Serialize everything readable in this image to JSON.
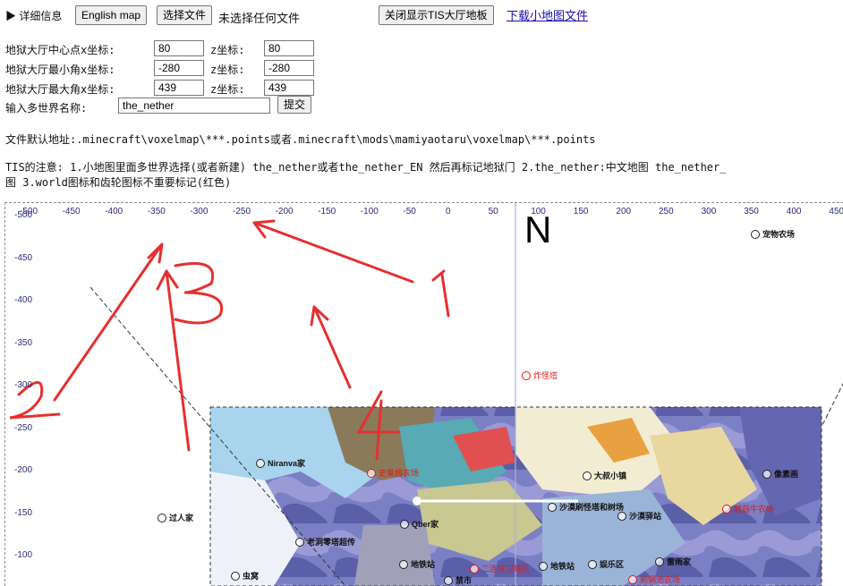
{
  "details_label": "▶ 详细信息",
  "buttons": {
    "english_map": "English map",
    "choose_file": "选择文件",
    "no_file": "未选择任何文件",
    "close_floor": "关闭显示TIS大厅地板",
    "download_link": "下载小地图文件",
    "submit": "提交"
  },
  "form": {
    "center_label": "地狱大厅中心点x坐标:",
    "center_x": "80",
    "center_z_label": "z坐标:",
    "center_z": "80",
    "min_label": "地狱大厅最小角x坐标:",
    "min_x": "-280",
    "min_z_label": "z坐标:",
    "min_z": "-280",
    "max_label": "地狱大厅最大角x坐标:",
    "max_x": "439",
    "max_z_label": "z坐标:",
    "max_z": "439",
    "world_label": "输入多世界名称:",
    "world_value": "the_nether"
  },
  "info": {
    "default_path": "文件默认地址:.minecraft\\voxelmap\\***.points或者.minecraft\\mods\\mamiyaotaru\\voxelmap\\***.points",
    "note_line1": "TIS的注意: 1.小地图里面多世界选择(或者新建) the_nether或者the_nether_EN 然后再标记地狱门 2.the_nether:中文地图 the_nether_",
    "note_line2": "图 3.world图标和齿轮图标不重要标记(红色)"
  },
  "annotations": [
    "1",
    "2",
    "3",
    "4"
  ],
  "map": {
    "north": "N",
    "x_ticks": [
      "-500",
      "-450",
      "-400",
      "-350",
      "-300",
      "-250",
      "-200",
      "-150",
      "-100",
      "-50",
      "0",
      "50",
      "100",
      "150",
      "200",
      "250",
      "300",
      "350",
      "400",
      "450"
    ],
    "y_ticks": [
      "-500",
      "-450",
      "-400",
      "-350",
      "-300",
      "-250",
      "-200",
      "-150",
      "-100"
    ],
    "markers": [
      {
        "name": "宠物农场",
        "color": "dark"
      },
      {
        "name": "炸怪塔",
        "color": "red"
      },
      {
        "name": "Niranva家",
        "color": "dark"
      },
      {
        "name": "史莱姆农场",
        "color": "red"
      },
      {
        "name": "大叔小镇",
        "color": "dark"
      },
      {
        "name": "像素画",
        "color": "dark"
      },
      {
        "name": "沙漠刷怪塔和树场",
        "color": "dark"
      },
      {
        "name": "沙漠驿站",
        "color": "dark"
      },
      {
        "name": "蘑菇牛农场",
        "color": "red"
      },
      {
        "name": "过人家",
        "color": "dark"
      },
      {
        "name": "Qber家",
        "color": "dark"
      },
      {
        "name": "老洞零塔超传",
        "color": "dark"
      },
      {
        "name": "地铁站",
        "color": "dark"
      },
      {
        "name": "二连守卫塔区",
        "color": "red"
      },
      {
        "name": "地铁站",
        "color": "dark"
      },
      {
        "name": "娱乐区",
        "color": "dark"
      },
      {
        "name": "雷雨家",
        "color": "dark"
      },
      {
        "name": "虫窝",
        "color": "dark"
      },
      {
        "name": "禁市",
        "color": "dark"
      },
      {
        "name": "刷钢池农场",
        "color": "red"
      }
    ]
  }
}
